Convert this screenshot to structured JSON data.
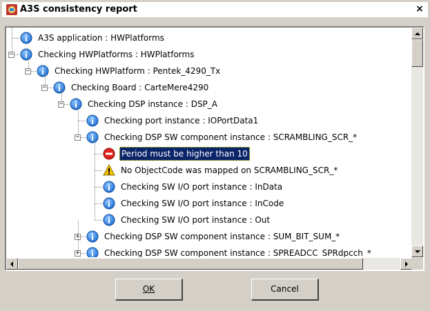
{
  "window": {
    "title": "A3S consistency report",
    "close_glyph": "×"
  },
  "tree": {
    "rows": [
      {
        "label": "A3S application : HWPlatforms",
        "icon": "info-icon",
        "level": 0,
        "expander": null
      },
      {
        "label": "Checking HWPlatforms : HWPlatforms",
        "icon": "info-icon",
        "level": 0,
        "expander": "−"
      },
      {
        "label": "Checking HWPlatform : Pentek_4290_Tx",
        "icon": "info-icon",
        "level": 1,
        "expander": "−"
      },
      {
        "label": "Checking Board : CarteMere4290",
        "icon": "info-icon",
        "level": 2,
        "expander": "−"
      },
      {
        "label": "Checking DSP instance : DSP_A",
        "icon": "info-icon",
        "level": 3,
        "expander": "−"
      },
      {
        "label": "Checking port instance : IOPortData1",
        "icon": "info-icon",
        "level": 4,
        "expander": null
      },
      {
        "label": "Checking DSP SW component instance : SCRAMBLING_SCR_*",
        "icon": "info-icon",
        "level": 4,
        "expander": "−"
      },
      {
        "label": "Period must be higher than 10",
        "icon": "error-icon",
        "level": 5,
        "expander": null,
        "selected": true
      },
      {
        "label": "No ObjectCode was mapped on SCRAMBLING_SCR_*",
        "icon": "warning-icon",
        "level": 5,
        "expander": null
      },
      {
        "label": "Checking SW I/O port instance : InData",
        "icon": "info-icon",
        "level": 5,
        "expander": null
      },
      {
        "label": "Checking SW I/O port instance : InCode",
        "icon": "info-icon",
        "level": 5,
        "expander": null
      },
      {
        "label": "Checking SW I/O port instance : Out",
        "icon": "info-icon",
        "level": 5,
        "expander": null
      },
      {
        "label": "Checking DSP SW component instance : SUM_BIT_SUM_*",
        "icon": "info-icon",
        "level": 4,
        "expander": "+"
      },
      {
        "label": "Checking DSP SW component instance : SPREADCC_SPRdpcch_*",
        "icon": "info-icon",
        "level": 4,
        "expander": "+"
      }
    ]
  },
  "buttons": {
    "ok_label": "OK",
    "cancel_label": "Cancel"
  },
  "colors": {
    "info": "#1c6fd6",
    "error": "#e0201c",
    "warning": "#f2c200",
    "selection": "#0a246a"
  }
}
